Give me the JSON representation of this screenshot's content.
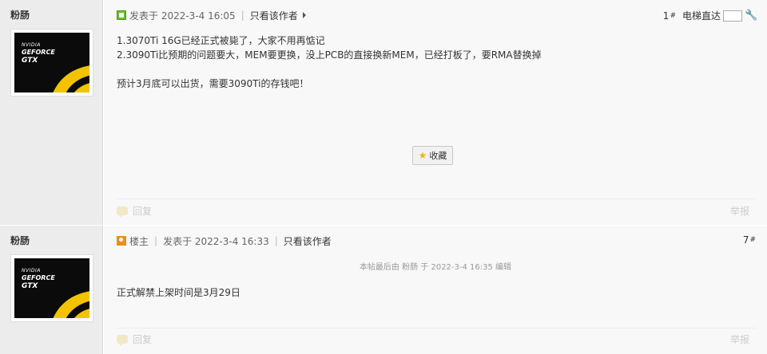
{
  "posts": [
    {
      "author": "粉肠",
      "avatar_text": {
        "brand": "NVIDIA",
        "line1": "GEFORCE",
        "line2": "GTX"
      },
      "icon": "user-green-icon",
      "posted_label": "发表于 2022-3-4 16:05",
      "only_author": "只看该作者",
      "floor_number": "1",
      "floor_suffix": "#",
      "jump_label": "电梯直达",
      "lines": [
        "1.3070Ti 16G已经正式被毙了，大家不用再惦记",
        "2.3090Ti比预期的问题要大，MEM要更换，没上PCB的直接换新MEM，已经打板了，要RMA替换掉",
        "",
        "预计3月底可以出货，需要3090Ti的存钱吧！"
      ],
      "favorite_label": "收藏",
      "reply_label": "回复",
      "report_label": "举报"
    },
    {
      "author": "粉肠",
      "avatar_text": {
        "brand": "NVIDIA",
        "line1": "GEFORCE",
        "line2": "GTX"
      },
      "icon": "user-orange-icon",
      "role_label": "楼主",
      "posted_label": "发表于 2022-3-4 16:33",
      "only_author": "只看该作者",
      "floor_number": "7",
      "floor_suffix": "#",
      "edit_note": "本帖最后由 粉肠 于 2022-3-4 16:35 编辑",
      "lines": [
        "正式解禁上架时间是3月29日"
      ],
      "reply_label": "回复",
      "report_label": "举报"
    }
  ]
}
